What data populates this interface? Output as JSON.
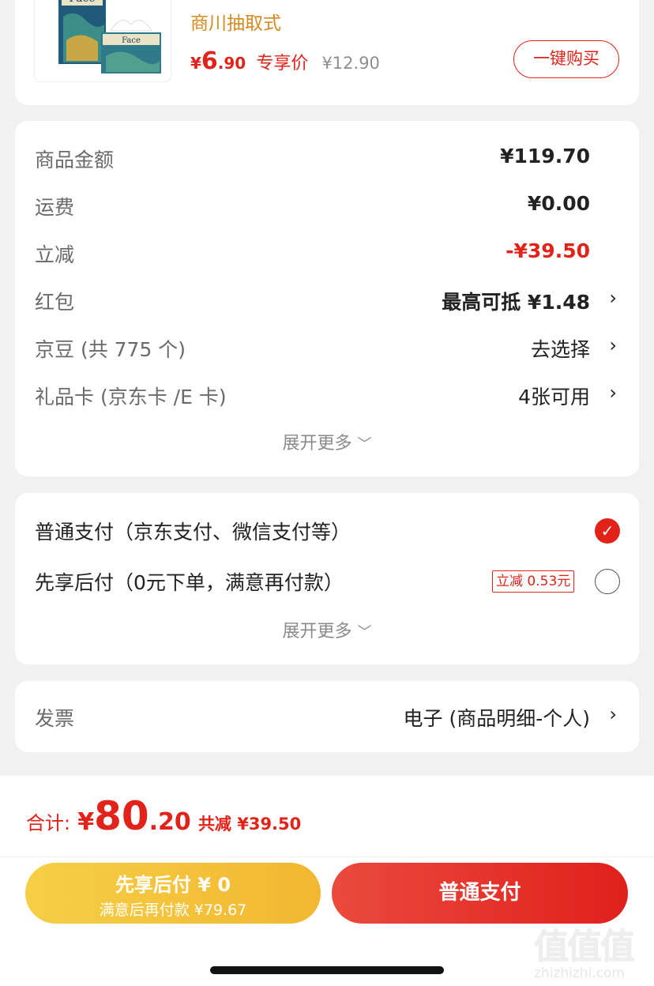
{
  "product": {
    "title": "商川抽取式",
    "price_symbol": "¥",
    "price_int": "6",
    "price_dec": ".90",
    "price_tag": "专享价",
    "orig_price": "¥12.90",
    "buy_button": "一键购买",
    "image_brand_text": "Face"
  },
  "summary": {
    "rows": [
      {
        "label": "商品金额",
        "value": "¥119.70"
      },
      {
        "label": "运费",
        "value": "¥0.00"
      },
      {
        "label": "立减",
        "value": "-¥39.50"
      },
      {
        "label": "红包",
        "value": "最高可抵 ¥1.48"
      },
      {
        "label": "京豆 (共 775 个)",
        "value": "去选择"
      },
      {
        "label": "礼品卡 (京东卡 /E 卡)",
        "value": "4张可用"
      }
    ],
    "expand_label": "展开更多"
  },
  "payment": {
    "option1": "普通支付（京东支付、微信支付等）",
    "option2": "先享后付（0元下单，满意再付款）",
    "option2_badge": "立减 0.53元",
    "expand_label": "展开更多"
  },
  "invoice": {
    "label": "发票",
    "value": "电子 (商品明细-个人)"
  },
  "total": {
    "label": "合计:",
    "symbol": "¥",
    "int": "80",
    "dec": ".20",
    "savings": "共减 ¥39.50"
  },
  "buttons": {
    "later_title": "先享后付 ¥ 0",
    "later_sub": "满意后再付款 ¥79.67",
    "pay": "普通支付"
  },
  "watermark": {
    "text": "值值值",
    "url": "zhizhizhi.com"
  },
  "colors": {
    "accent": "#e2231a",
    "price_gold": "#d48a1f",
    "later_button": "#f4c542",
    "pay_button": "#e8302d"
  }
}
